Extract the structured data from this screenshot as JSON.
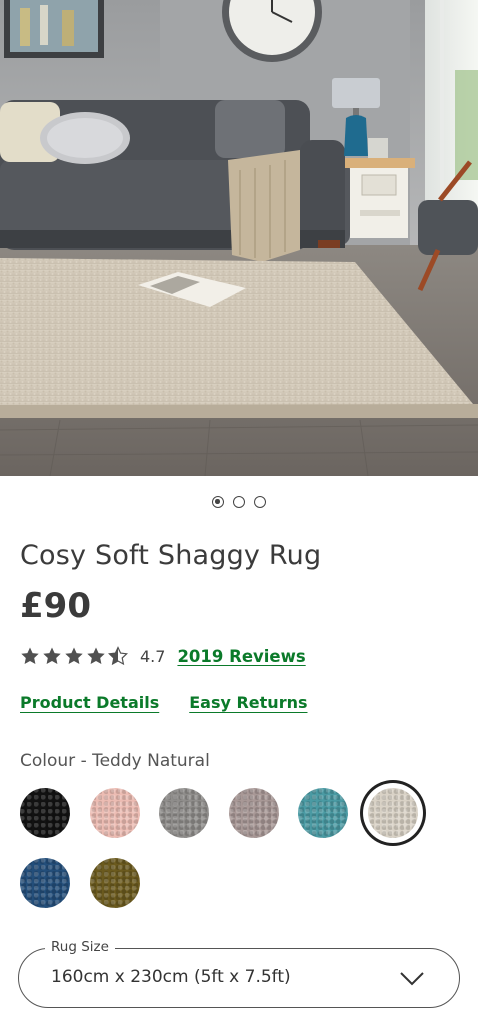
{
  "product": {
    "title": "Cosy Soft Shaggy Rug",
    "price": "£90",
    "rating": 4.5,
    "rating_text": "4.7",
    "reviews_label": "2019 Reviews"
  },
  "gallery": {
    "image_count": 3,
    "active_index": 0
  },
  "links": {
    "product_details": "Product Details",
    "easy_returns": "Easy Returns"
  },
  "colour": {
    "label": "Colour - Teddy Natural",
    "swatches": [
      {
        "name": "Black",
        "color": "#121212"
      },
      {
        "name": "Blush",
        "color": "#ecbcb3"
      },
      {
        "name": "Grey",
        "color": "#8f8d8b"
      },
      {
        "name": "Mink",
        "color": "#a89896"
      },
      {
        "name": "Teal",
        "color": "#4a9aa3"
      },
      {
        "name": "Teddy Natural",
        "color": "#d9d2c6",
        "selected": true
      },
      {
        "name": "Navy",
        "color": "#234e7a"
      },
      {
        "name": "Ochre",
        "color": "#6b5a1e"
      }
    ]
  },
  "size": {
    "label": "Rug Size",
    "value": "160cm x 230cm (5ft x 7.5ft)"
  },
  "colors": {
    "link_green": "#0b7a2a",
    "text_dark": "#3b3b3b"
  }
}
